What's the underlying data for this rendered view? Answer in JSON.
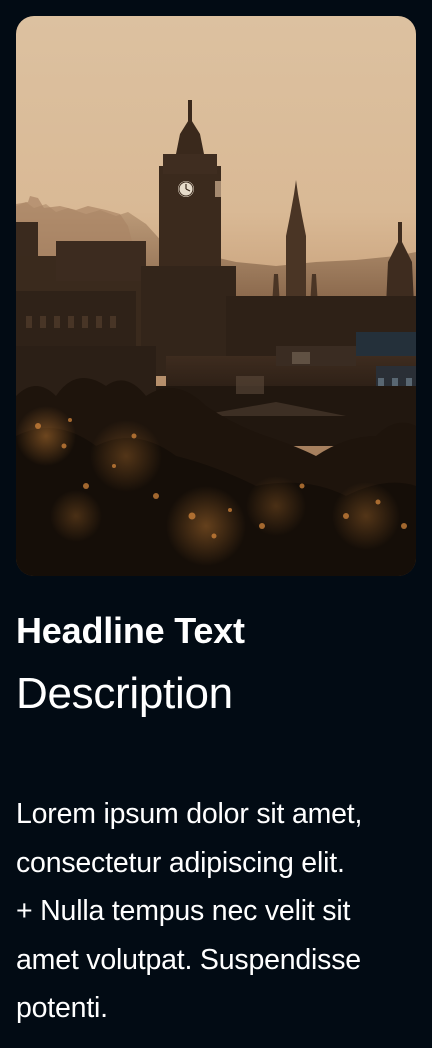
{
  "card": {
    "image": {
      "alt": "",
      "colors": {
        "sky_top": "#e2c7a6",
        "sky_bottom": "#cfae88",
        "city": "#3a2a1d",
        "foliage": "#1c120a",
        "highlight": "#c9732c"
      }
    },
    "headline": "Headline Text",
    "description": "Description",
    "body_lines": [
      "Lorem ipsum dolor sit amet,",
      "consectetur adipiscing elit.",
      "+ Nulla tempus nec velit sit",
      "amet volutpat. Suspendisse",
      "potenti."
    ]
  }
}
